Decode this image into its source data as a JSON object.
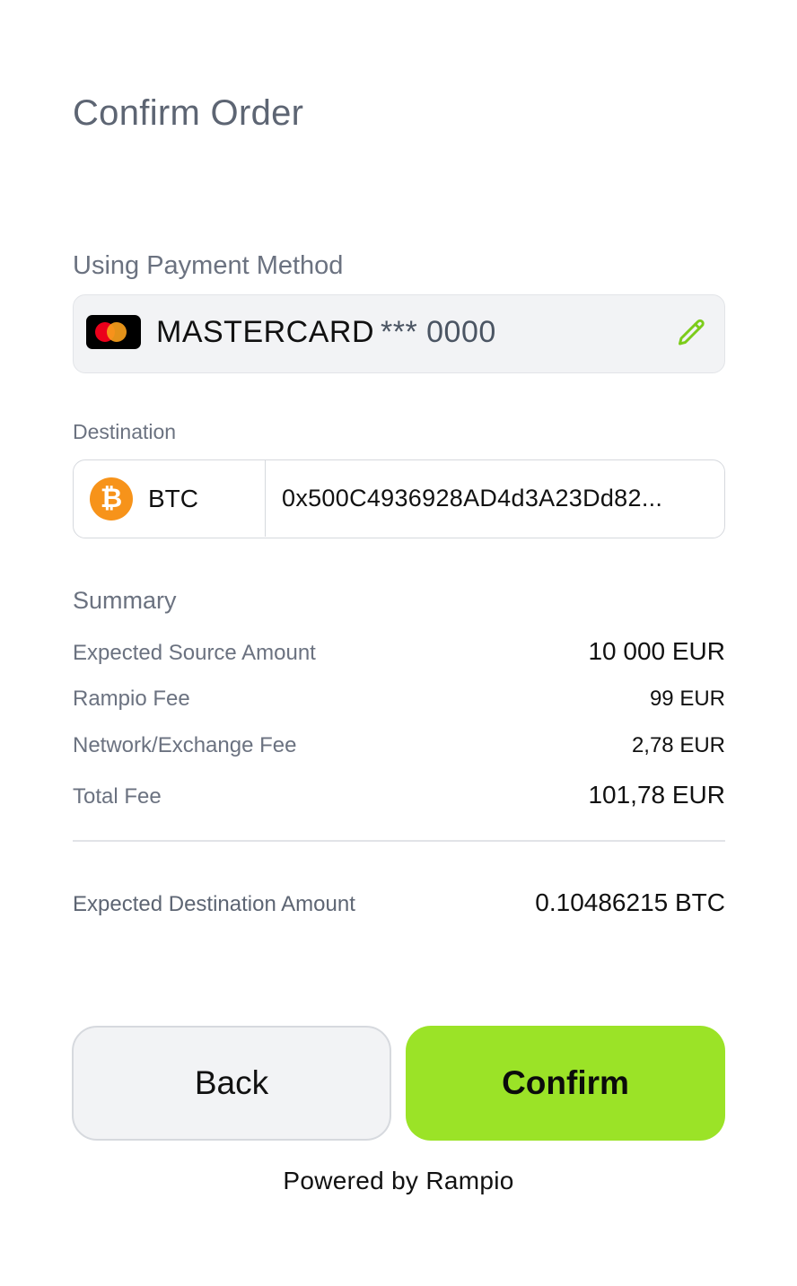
{
  "page": {
    "title": "Confirm Order"
  },
  "payment_method": {
    "label": "Using Payment Method",
    "card_brand": "MASTERCARD",
    "card_mask": "*** 0000",
    "icon": "mastercard-logo",
    "edit_icon": "pencil-icon",
    "accent_color": "#9be327"
  },
  "destination": {
    "label": "Destination",
    "asset": "BTC",
    "asset_icon": "bitcoin-icon",
    "asset_color": "#f7931a",
    "address": "0x500C4936928AD4d3A23Dd82..."
  },
  "summary": {
    "label": "Summary",
    "rows": [
      {
        "key": "Expected Source Amount",
        "value": "10 000 EUR"
      },
      {
        "key": "Rampio Fee",
        "value": "99 EUR"
      },
      {
        "key": "Network/Exchange Fee",
        "value": "2,78 EUR"
      },
      {
        "key": "Total Fee",
        "value": "101,78 EUR"
      }
    ],
    "destination_amount_label": "Expected Destination Amount",
    "destination_amount_value": "0.10486215 BTC"
  },
  "actions": {
    "back_label": "Back",
    "confirm_label": "Confirm"
  },
  "footer": {
    "powered_by": "Powered by Rampio"
  }
}
